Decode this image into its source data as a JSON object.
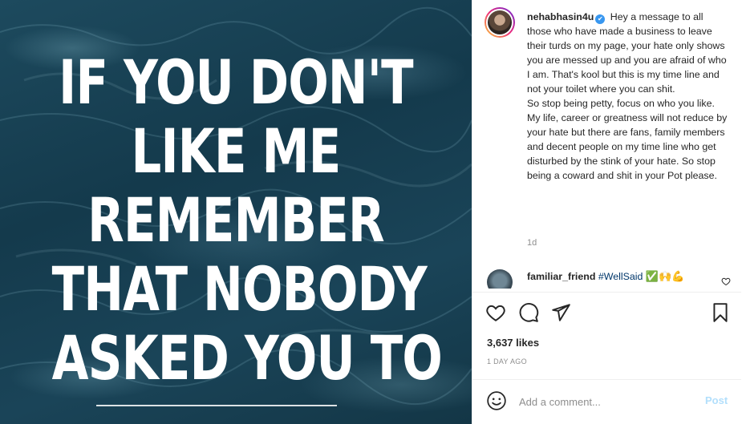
{
  "image": {
    "quote_lines": [
      "IF YOU DON'T",
      "LIKE ME",
      "REMEMBER",
      "THAT NOBODY",
      "ASKED YOU TO"
    ]
  },
  "post": {
    "username": "nehabhasin4u",
    "verified_icon": "verified-badge-icon",
    "caption_paragraphs": [
      "Hey a message to all those who have made a business to leave their turds on my page, your hate only shows you are messed up and you are afraid of who I am. That's kool but this is my time line and not your toilet where you can shit.",
      "So stop being petty, focus on who you like.",
      "My life, career or greatness will not reduce by your hate but there are fans, family members and decent people on my time line who get disturbed by the stink of your hate. So stop being a coward and shit in your Pot please."
    ],
    "time_ago": "1d"
  },
  "comments": [
    {
      "username": "familiar_friend",
      "hashtag": "#WellSaid",
      "emojis": "✅🙌💪"
    }
  ],
  "actions": {
    "icons": [
      "heart-icon",
      "comment-icon",
      "share-icon",
      "bookmark-icon"
    ]
  },
  "likes_text": "3,637 likes",
  "date_text": "1 DAY AGO",
  "comment_box": {
    "placeholder": "Add a comment...",
    "post_label": "Post"
  },
  "colors": {
    "link_blue": "#00376b",
    "verified_blue": "#3897f0",
    "post_disabled": "#b2dffc",
    "muted": "#8e8e8e"
  }
}
